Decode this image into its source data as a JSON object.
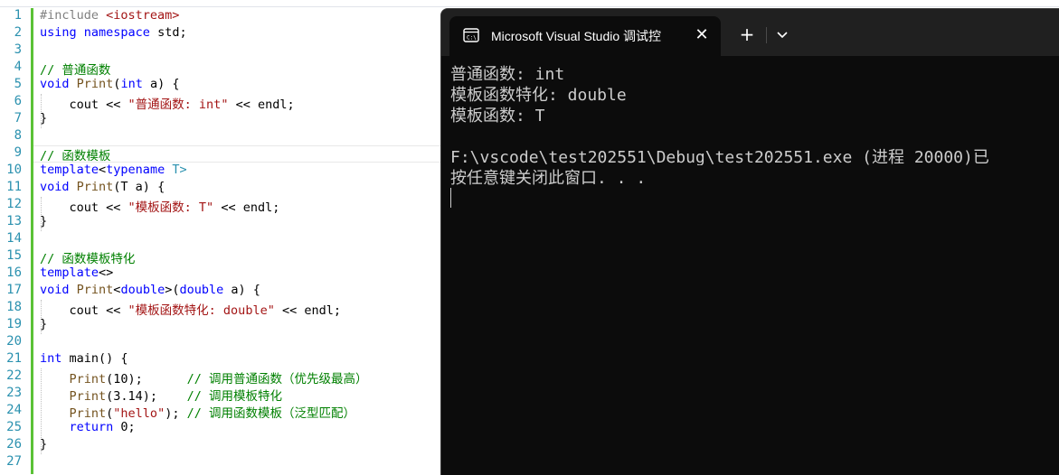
{
  "editor": {
    "line_numbers": [
      "1",
      "2",
      "3",
      "4",
      "5",
      "6",
      "7",
      "8",
      "9",
      "10",
      "11",
      "12",
      "13",
      "14",
      "15",
      "16",
      "17",
      "18",
      "19",
      "20",
      "21",
      "22",
      "23",
      "24",
      "25",
      "26",
      "27"
    ],
    "lines": [
      [
        {
          "t": "#include ",
          "c": "pp"
        },
        {
          "t": "<iostream>",
          "c": "ppk"
        }
      ],
      [
        {
          "t": "using",
          "c": "kw"
        },
        {
          "t": " ",
          "c": ""
        },
        {
          "t": "namespace",
          "c": "kw"
        },
        {
          "t": " std;",
          "c": ""
        }
      ],
      [],
      [
        {
          "t": "// 普通函数",
          "c": "cmt"
        }
      ],
      [
        {
          "t": "void",
          "c": "kw"
        },
        {
          "t": " ",
          "c": ""
        },
        {
          "t": "Print",
          "c": "fn"
        },
        {
          "t": "(",
          "c": ""
        },
        {
          "t": "int",
          "c": "kw"
        },
        {
          "t": " a) {",
          "c": ""
        }
      ],
      [
        {
          "t": "    cout << ",
          "c": ""
        },
        {
          "t": "\"普通函数: int\"",
          "c": "str"
        },
        {
          "t": " << endl;",
          "c": ""
        }
      ],
      [
        {
          "t": "}",
          "c": ""
        }
      ],
      [],
      [
        {
          "t": "// 函数模板",
          "c": "cmt"
        }
      ],
      [
        {
          "t": "template",
          "c": "kw"
        },
        {
          "t": "<",
          "c": ""
        },
        {
          "t": "typename",
          "c": "kw"
        },
        {
          "t": " T>",
          "c": "ty"
        }
      ],
      [
        {
          "t": "void",
          "c": "kw"
        },
        {
          "t": " ",
          "c": ""
        },
        {
          "t": "Print",
          "c": "fn"
        },
        {
          "t": "(T a) {",
          "c": ""
        }
      ],
      [
        {
          "t": "    cout << ",
          "c": ""
        },
        {
          "t": "\"模板函数: T\"",
          "c": "str"
        },
        {
          "t": " << endl;",
          "c": ""
        }
      ],
      [
        {
          "t": "}",
          "c": ""
        }
      ],
      [],
      [
        {
          "t": "// 函数模板特化",
          "c": "cmt"
        }
      ],
      [
        {
          "t": "template",
          "c": "kw"
        },
        {
          "t": "<>",
          "c": ""
        }
      ],
      [
        {
          "t": "void",
          "c": "kw"
        },
        {
          "t": " ",
          "c": ""
        },
        {
          "t": "Print",
          "c": "fn"
        },
        {
          "t": "<",
          "c": ""
        },
        {
          "t": "double",
          "c": "kw"
        },
        {
          "t": ">(",
          "c": ""
        },
        {
          "t": "double",
          "c": "kw"
        },
        {
          "t": " a) {",
          "c": ""
        }
      ],
      [
        {
          "t": "    cout << ",
          "c": ""
        },
        {
          "t": "\"模板函数特化: double\"",
          "c": "str"
        },
        {
          "t": " << endl;",
          "c": ""
        }
      ],
      [
        {
          "t": "}",
          "c": ""
        }
      ],
      [],
      [
        {
          "t": "int",
          "c": "kw"
        },
        {
          "t": " main() {",
          "c": ""
        }
      ],
      [
        {
          "t": "    ",
          "c": ""
        },
        {
          "t": "Print",
          "c": "fn"
        },
        {
          "t": "(10);      ",
          "c": ""
        },
        {
          "t": "// 调用普通函数（优先级最高）",
          "c": "cmt"
        }
      ],
      [
        {
          "t": "    ",
          "c": ""
        },
        {
          "t": "Print",
          "c": "fn"
        },
        {
          "t": "(3.14);    ",
          "c": ""
        },
        {
          "t": "// 调用模板特化",
          "c": "cmt"
        }
      ],
      [
        {
          "t": "    ",
          "c": ""
        },
        {
          "t": "Print",
          "c": "fn"
        },
        {
          "t": "(",
          "c": ""
        },
        {
          "t": "\"hello\"",
          "c": "str"
        },
        {
          "t": "); ",
          "c": ""
        },
        {
          "t": "// 调用函数模板（泛型匹配）",
          "c": "cmt"
        }
      ],
      [
        {
          "t": "    ",
          "c": ""
        },
        {
          "t": "return",
          "c": "kw"
        },
        {
          "t": " 0;",
          "c": ""
        }
      ],
      [
        {
          "t": "}",
          "c": ""
        }
      ],
      []
    ]
  },
  "terminal": {
    "tab_title": "Microsoft Visual Studio 调试控",
    "tab_icon": "console-icon",
    "close_icon": "close-icon",
    "new_tab_label": "+",
    "dropdown_icon": "chevron-down-icon",
    "output": [
      "普通函数: int",
      "模板函数特化: double",
      "模板函数: T",
      "",
      "F:\\vscode\\test202551\\Debug\\test202551.exe (进程 20000)已",
      "按任意键关闭此窗口. . ."
    ]
  },
  "colors": {
    "keyword": "#0000ff",
    "type": "#2b91af",
    "string": "#a31515",
    "comment": "#008000",
    "line_number": "#2b91af",
    "change_bar": "#5bc236",
    "terminal_bg": "#0c0c0c",
    "terminal_fg": "#cccccc"
  }
}
